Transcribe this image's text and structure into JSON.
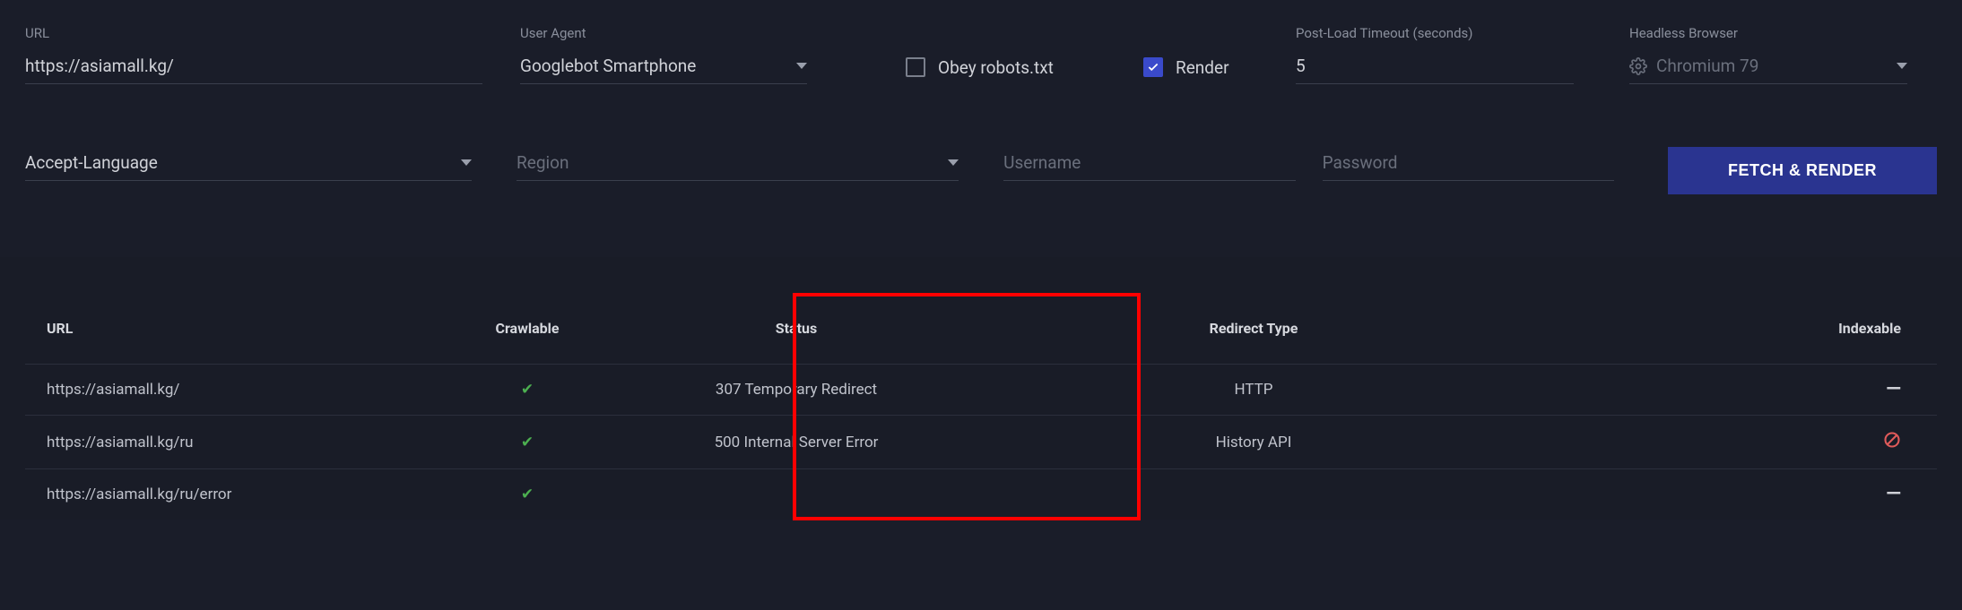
{
  "form": {
    "url": {
      "label": "URL",
      "value": "https://asiamall.kg/"
    },
    "user_agent": {
      "label": "User Agent",
      "value": "Googlebot Smartphone"
    },
    "obey_robots": {
      "label": "Obey robots.txt",
      "checked": false
    },
    "render": {
      "label": "Render",
      "checked": true
    },
    "timeout": {
      "label": "Post-Load Timeout (seconds)",
      "value": "5"
    },
    "browser": {
      "label": "Headless Browser",
      "value": "Chromium 79"
    },
    "accept_language": {
      "placeholder": "Accept-Language"
    },
    "region": {
      "placeholder": "Region"
    },
    "username": {
      "placeholder": "Username"
    },
    "password": {
      "placeholder": "Password"
    },
    "fetch_button": "FETCH & RENDER"
  },
  "results": {
    "headers": {
      "url": "URL",
      "crawlable": "Crawlable",
      "status": "Status",
      "redirect_type": "Redirect Type",
      "indexable": "Indexable"
    },
    "rows": [
      {
        "url": "https://asiamall.kg/",
        "crawlable": "check",
        "status": "307 Temporary Redirect",
        "redirect_type": "HTTP",
        "indexable": "minus"
      },
      {
        "url": "https://asiamall.kg/ru",
        "crawlable": "check",
        "status": "500 Internal Server Error",
        "redirect_type": "History API",
        "indexable": "noentry"
      },
      {
        "url": "https://asiamall.kg/ru/error",
        "crawlable": "check",
        "status": "",
        "redirect_type": "",
        "indexable": "minus"
      }
    ]
  }
}
